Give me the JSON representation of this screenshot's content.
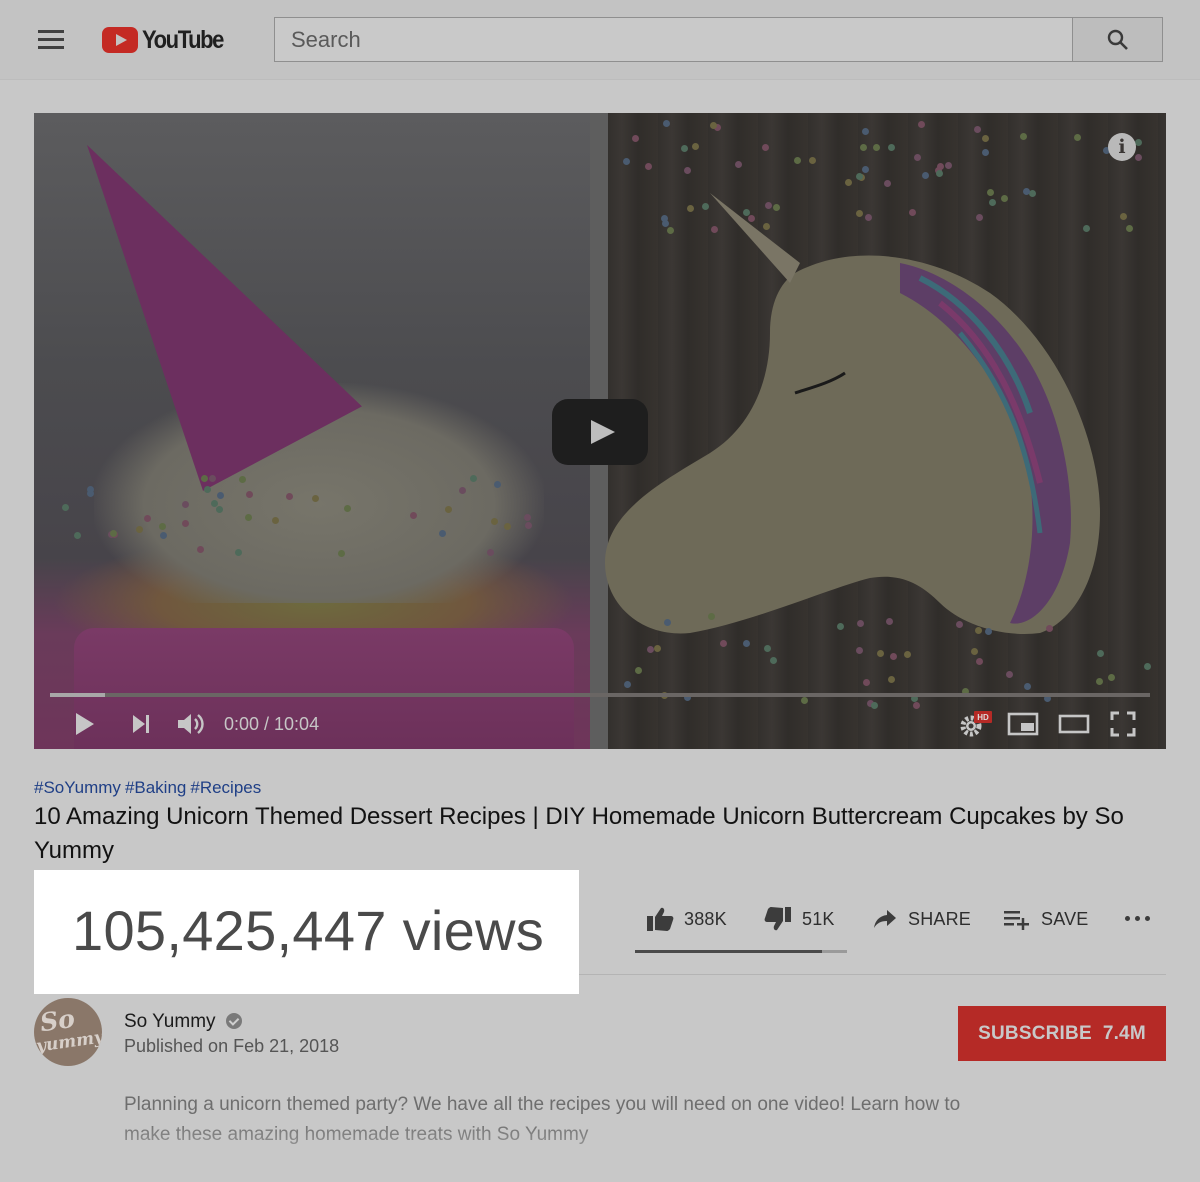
{
  "header": {
    "logo_text": "YouTube",
    "search_placeholder": "Search"
  },
  "player": {
    "time": "0:00 / 10:04",
    "progress": 0.05,
    "hd_badge": "HD"
  },
  "video": {
    "tags": [
      "#SoYummy",
      "#Baking",
      "#Recipes"
    ],
    "title": "10 Amazing Unicorn Themed Dessert Recipes | DIY Homemade Unicorn Buttercream Cupcakes by So Yummy",
    "views": "105,425,447 views"
  },
  "actions": {
    "likes": "388K",
    "dislikes": "51K",
    "share_label": "SHARE",
    "save_label": "SAVE",
    "like_ratio": 0.88
  },
  "channel": {
    "avatar_text_top": "So",
    "avatar_text_bottom": "yummy",
    "name": "So Yummy",
    "published": "Published on Feb 21, 2018",
    "subscribe_label": "SUBSCRIBE",
    "subscriber_count": "7.4M"
  },
  "description": {
    "text": "Planning a unicorn themed party? We have all the recipes you will need on one video! Learn how to make these amazing homemade treats with So Yummy"
  },
  "colors": {
    "overlay_background": "#c8c8c8",
    "subscribe_red": "#b52a26",
    "highlight_box": "#ffffff",
    "tag_blue": "#1f3f86"
  },
  "icons": [
    "hamburger-menu-icon",
    "youtube-logo-icon",
    "search-icon",
    "info-icon",
    "play-icon",
    "next-icon",
    "volume-icon",
    "settings-icon",
    "miniplayer-icon",
    "theater-icon",
    "fullscreen-icon",
    "thumbs-up-icon",
    "thumbs-down-icon",
    "share-icon",
    "add-to-playlist-icon",
    "more-icon",
    "verified-icon"
  ]
}
